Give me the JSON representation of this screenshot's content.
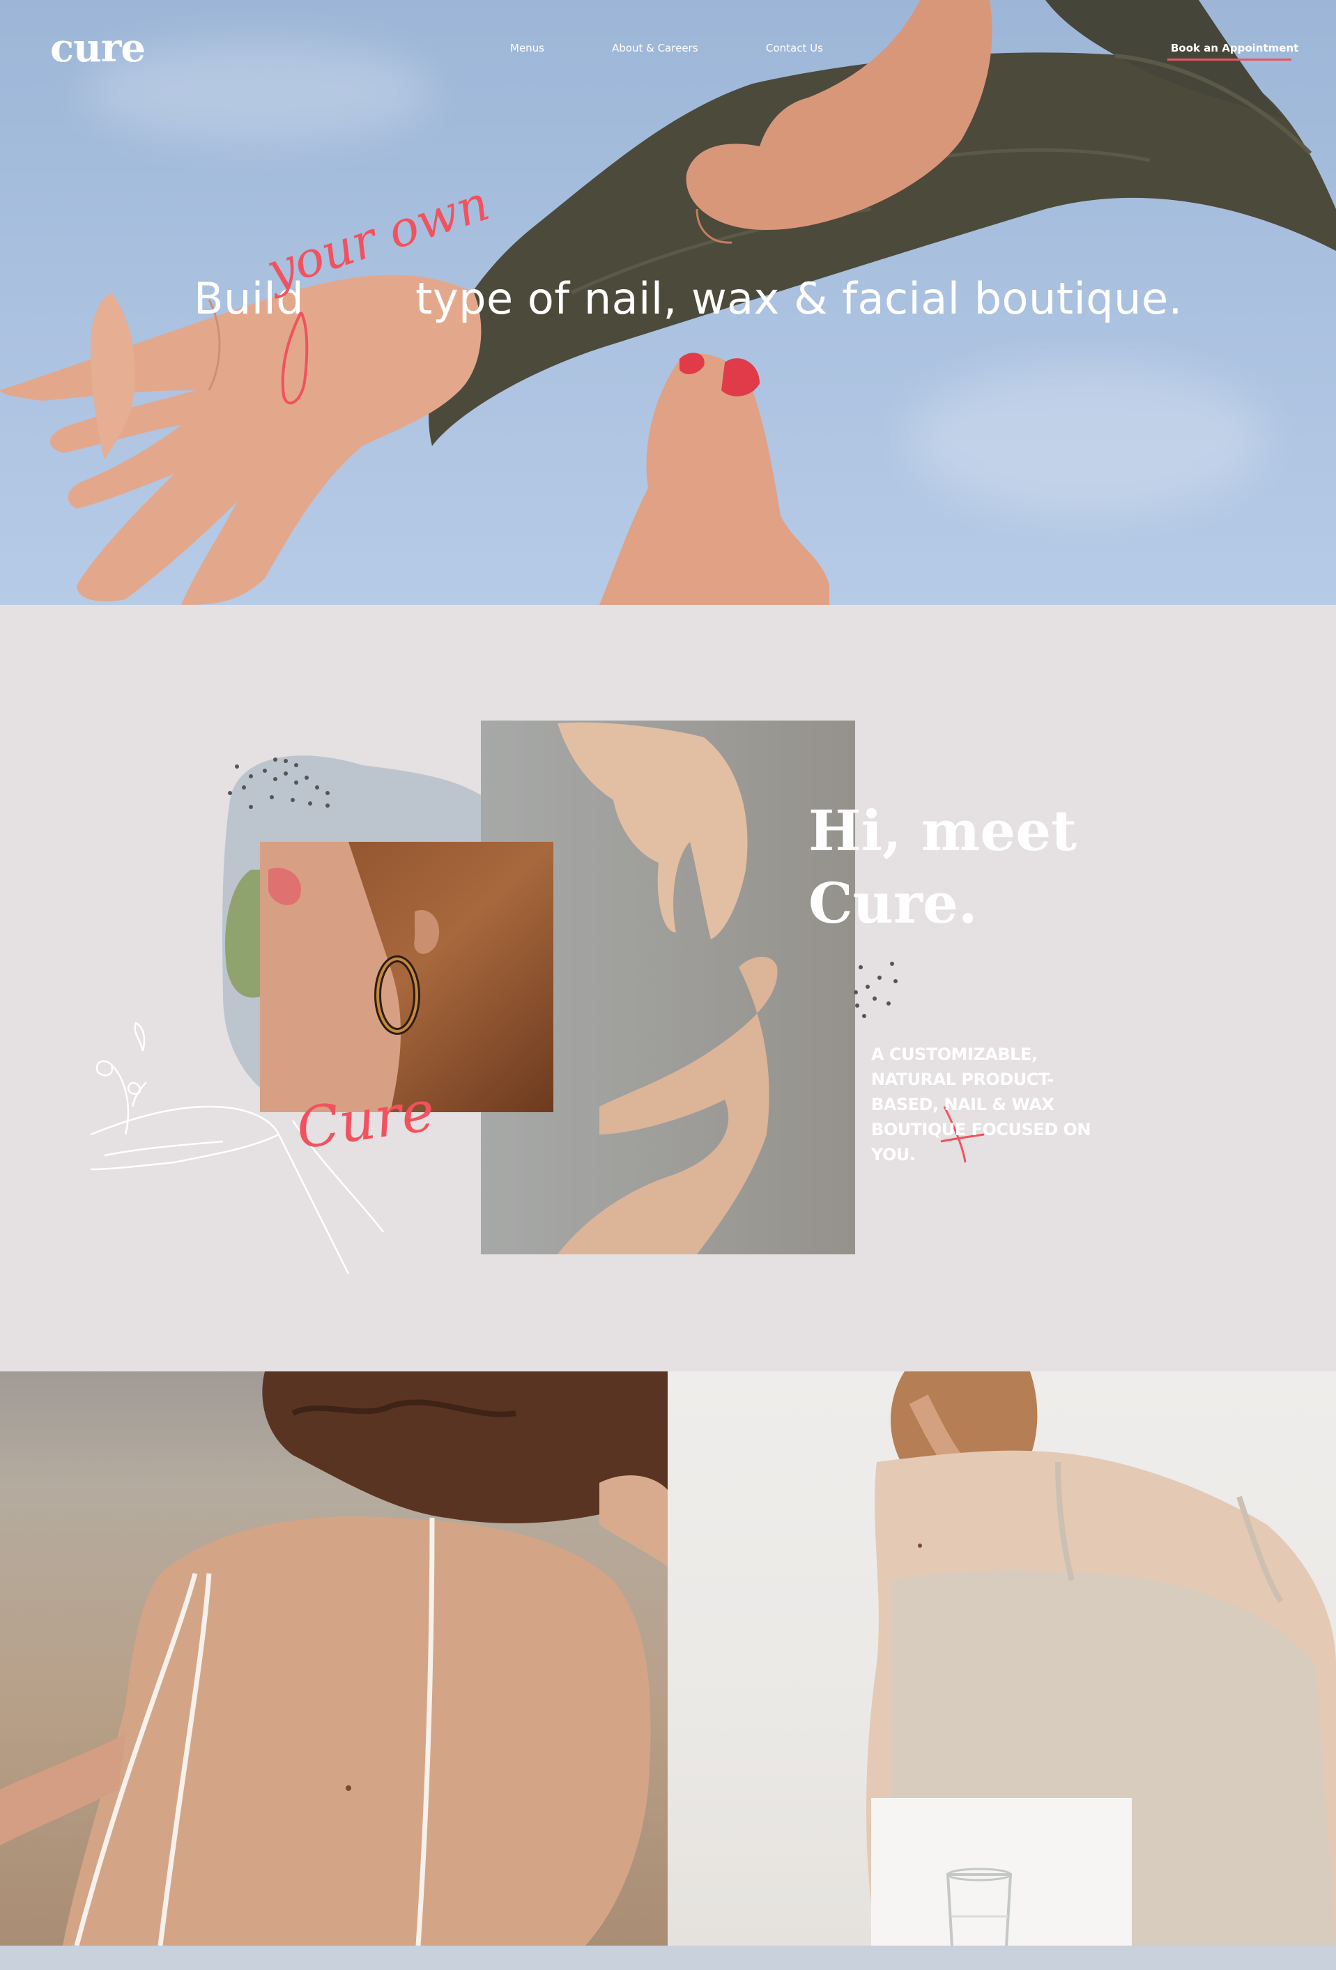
{
  "header": {
    "logo": "cure",
    "nav": {
      "menus": "Menus",
      "about": "About & Careers",
      "contact": "Contact Us",
      "book": "Book an Appointment"
    }
  },
  "hero": {
    "headline_start": "Build",
    "headline_script": "your own",
    "headline_end": "type of nail, wax & facial boutique."
  },
  "meet": {
    "title_line1": "Hi, meet",
    "title_line2": "Cure.",
    "subtitle": "A CUSTOMIZABLE, NATURAL PRODUCT-BASED, NAIL & WAX BOUTIQUE FOCUSED ON YOU.",
    "script_word": "Cure"
  },
  "colors": {
    "accent": "#f1525e",
    "section_bg": "#e5e0e1",
    "sky": "#a9c0df"
  }
}
